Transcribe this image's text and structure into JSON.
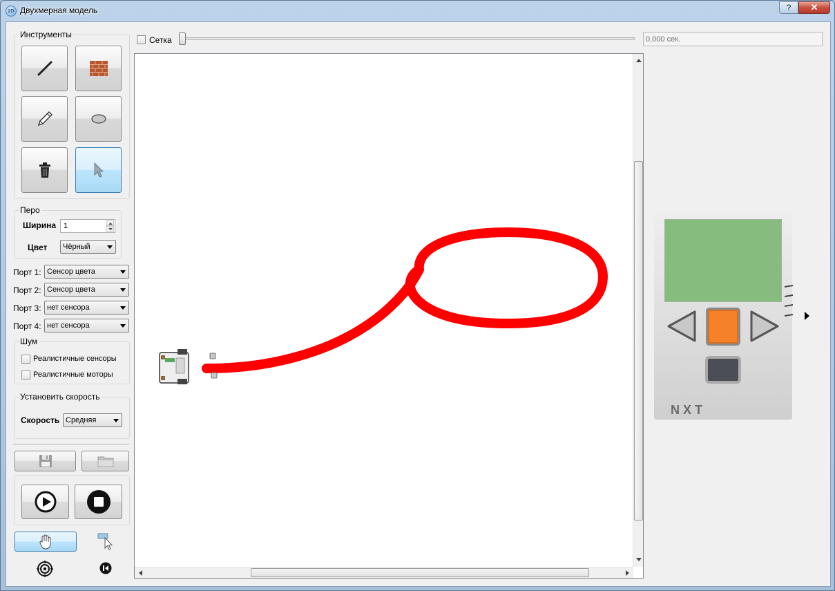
{
  "window": {
    "title": "Двухмерная модель",
    "help_label": "?",
    "close_label": "✕",
    "app_icon_label": "2D"
  },
  "tools": {
    "title": "Инструменты",
    "items": [
      {
        "name": "line-tool",
        "icon": "line-icon"
      },
      {
        "name": "wall-tool",
        "icon": "brick-wall-icon"
      },
      {
        "name": "pencil-tool",
        "icon": "pencil-icon"
      },
      {
        "name": "ellipse-tool",
        "icon": "ellipse-icon"
      },
      {
        "name": "delete-tool",
        "icon": "trash-icon"
      },
      {
        "name": "select-tool",
        "icon": "cursor-icon",
        "active": true
      }
    ]
  },
  "pen": {
    "title": "Перо",
    "width_label": "Ширина",
    "width_value": "1",
    "color_label": "Цвет",
    "color_value": "Чёрный"
  },
  "ports": [
    {
      "label": "Порт 1:",
      "value": "Сенсор цвета"
    },
    {
      "label": "Порт 2:",
      "value": "Сенсор цвета"
    },
    {
      "label": "Порт 3:",
      "value": "нет сенсора"
    },
    {
      "label": "Порт 4:",
      "value": "нет сенсора"
    }
  ],
  "noise": {
    "title": "Шум",
    "realistic_sensors": "Реалистичные сенсоры",
    "realistic_motors": "Реалистичные моторы"
  },
  "speed": {
    "title": "Установить скорость",
    "label": "Скорость",
    "value": "Средняя"
  },
  "top_bar": {
    "grid_label": "Сетка",
    "time_value": "0,000 сек.",
    "slider_level": 0
  },
  "nxt": {
    "brand": "NXT",
    "screen_color": "#86bd7e",
    "center_button_color": "#f5822b"
  },
  "trace_color": "#ff0000",
  "icons": {
    "save": "floppy-disk-icon",
    "open": "folder-icon",
    "play": "play-icon",
    "stop": "stop-icon",
    "hand": "hand-icon",
    "drag": "cursor-with-rect-icon",
    "target": "target-icon",
    "reset": "reset-icon"
  }
}
